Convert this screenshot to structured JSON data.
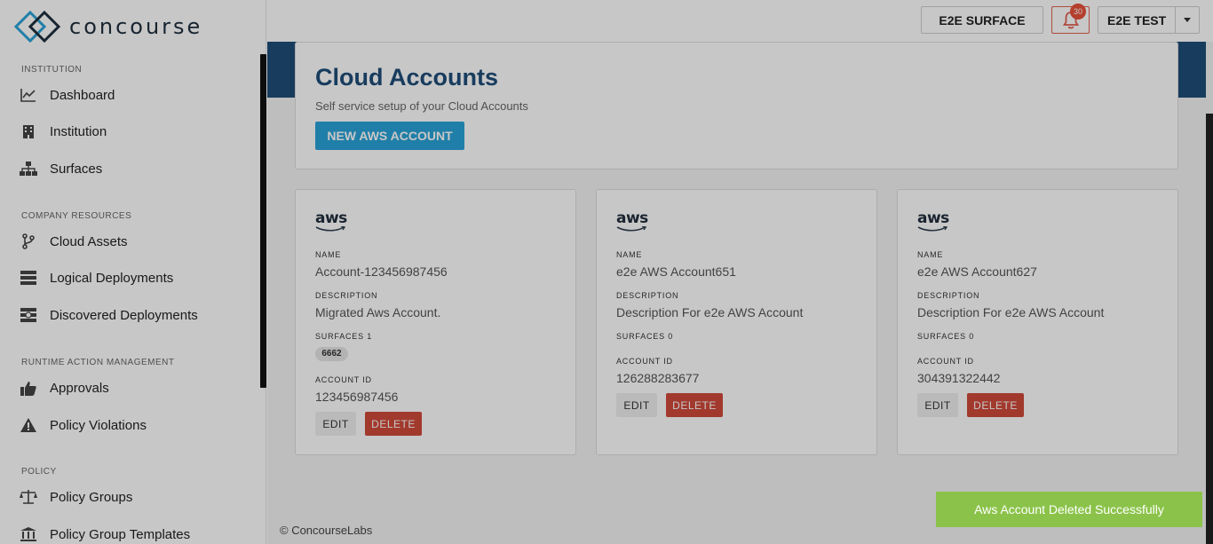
{
  "app": {
    "logo_text": "concourse"
  },
  "sidebar": {
    "sections": [
      {
        "title": "INSTITUTION",
        "items": [
          {
            "label": "Dashboard",
            "icon": "chart-line-icon"
          },
          {
            "label": "Institution",
            "icon": "building-icon"
          },
          {
            "label": "Surfaces",
            "icon": "sitemap-icon"
          }
        ]
      },
      {
        "title": "COMPANY RESOURCES",
        "items": [
          {
            "label": "Cloud Assets",
            "icon": "code-branch-icon"
          },
          {
            "label": "Logical Deployments",
            "icon": "server-icon"
          },
          {
            "label": "Discovered Deployments",
            "icon": "search-server-icon"
          }
        ]
      },
      {
        "title": "RUNTIME ACTION MANAGEMENT",
        "items": [
          {
            "label": "Approvals",
            "icon": "thumbs-up-icon"
          },
          {
            "label": "Policy Violations",
            "icon": "warning-icon"
          }
        ]
      },
      {
        "title": "POLICY",
        "items": [
          {
            "label": "Policy Groups",
            "icon": "balance-scale-icon"
          },
          {
            "label": "Policy Group Templates",
            "icon": "bank-icon"
          }
        ]
      }
    ]
  },
  "topbar": {
    "surface_label": "E2E SURFACE",
    "notification_count": "30",
    "user_label": "E2E TEST"
  },
  "page": {
    "title": "Cloud Accounts",
    "subtitle": "Self service setup of your Cloud Accounts",
    "new_button": "NEW AWS ACCOUNT"
  },
  "labels": {
    "name": "NAME",
    "description": "DESCRIPTION",
    "account_id": "ACCOUNT ID",
    "edit": "EDIT",
    "delete": "DELETE",
    "aws": "aws"
  },
  "accounts": [
    {
      "name": "Account-123456987456",
      "description": "Migrated Aws Account.",
      "surfaces_label": "SURFACES 1",
      "surface_chips": [
        "6662"
      ],
      "account_id": "123456987456"
    },
    {
      "name": "e2e AWS Account651",
      "description": "Description For e2e AWS Account",
      "surfaces_label": "SURFACES 0",
      "surface_chips": [],
      "account_id": "126288283677"
    },
    {
      "name": "e2e AWS Account627",
      "description": "Description For e2e AWS Account",
      "surfaces_label": "SURFACES 0",
      "surface_chips": [],
      "account_id": "304391322442"
    }
  ],
  "footer": {
    "copyright": "© ConcourseLabs"
  },
  "toast": {
    "message": "Aws Account Deleted Successfully"
  },
  "colors": {
    "brand_navy": "#1f4e79",
    "primary_button": "#2aa3d8",
    "danger": "#d0493a",
    "success_toast": "#8bc34a"
  }
}
